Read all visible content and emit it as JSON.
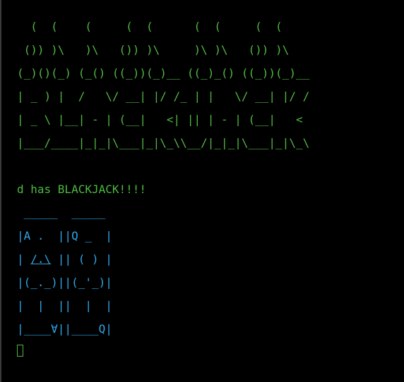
{
  "colors": {
    "background": "#000000",
    "banner": "#4fb840",
    "message": "#4fb840",
    "cards": "#2fa6e8",
    "cursor": "#4fb840"
  },
  "banner": [
    "  (  (    (     (  (      (  (     (  (",
    " ()) )\\   )\\   ()) )\\     )\\ )\\   ()) )\\",
    "(_)()(_) (_() ((_))(_)__ ((_)_() ((_))(_)__",
    "| _ ) |  /   \\/ __| |/ /_ | |   \\/ __| |/ /",
    "| _ \\ |__| - | (__|   <| || | - | (__|   <",
    "|___/____|_|_|\\___|_|\\_\\\\__/|_|_|\\___|_|\\_\\"
  ],
  "message": "d has BLACKJACK!!!!",
  "cards": {
    "row1": " _____  _____",
    "row2": "|A .  ||Q _  |",
    "row3_a": "| ",
    "row3_b": "/.\\",
    "row3_c": " || ( ) |",
    "row4": "|(_._)||(_'_)|",
    "row5": "|  |  ||  |  |",
    "row6": "|____∀||____Q|"
  },
  "cursor_icon": "prompt-cursor-icon"
}
